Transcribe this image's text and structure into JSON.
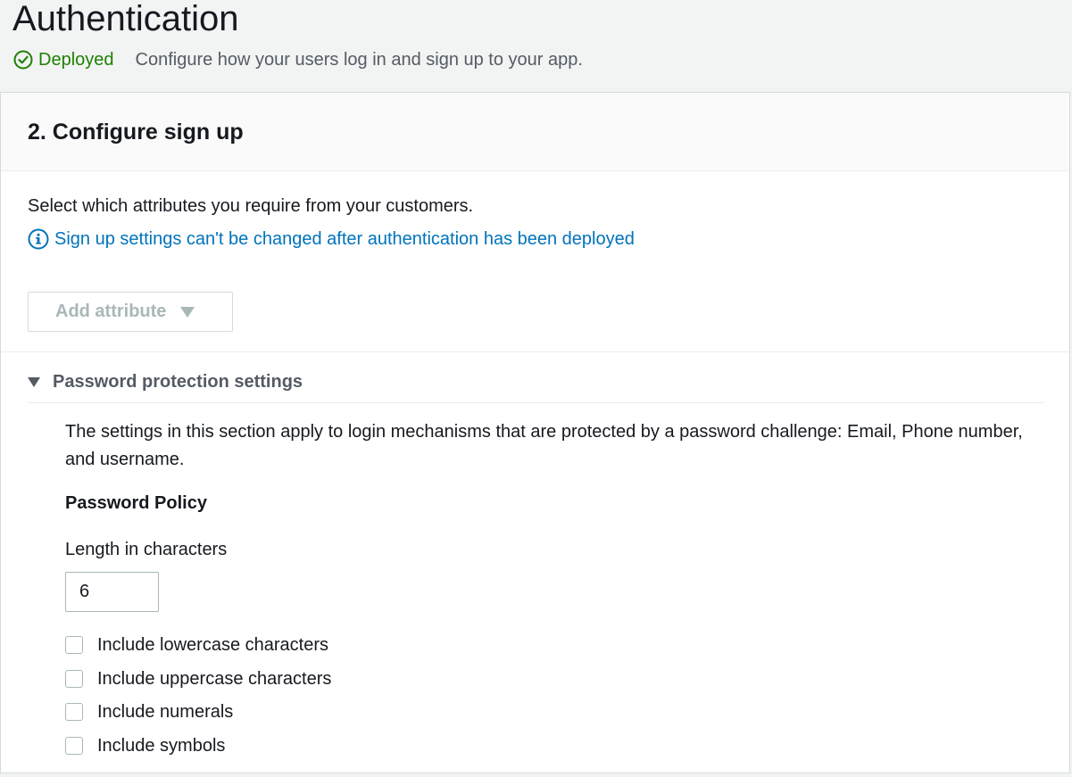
{
  "header": {
    "title": "Authentication",
    "status": "Deployed",
    "subtitle": "Configure how your users log in and sign up to your app."
  },
  "panel": {
    "title": "2. Configure sign up",
    "description": "Select which attributes you require from your customers.",
    "info": "Sign up settings can't be changed after authentication has been deployed",
    "add_attribute_label": "Add attribute"
  },
  "password": {
    "expander_label": "Password protection settings",
    "description": "The settings in this section apply to login mechanisms that are protected by a password challenge: Email, Phone number, and username.",
    "policy_heading": "Password Policy",
    "length_label": "Length in characters",
    "length_value": "6",
    "options": [
      {
        "label": "Include lowercase characters",
        "checked": false
      },
      {
        "label": "Include uppercase characters",
        "checked": false
      },
      {
        "label": "Include numerals",
        "checked": false
      },
      {
        "label": "Include symbols",
        "checked": false
      }
    ]
  },
  "colors": {
    "success": "#1d8102",
    "link": "#0073bb",
    "disabled": "#aab7b8"
  },
  "icons": {
    "status": "check-circle-icon",
    "info": "info-circle-icon",
    "dropdown": "caret-down-icon",
    "expander": "caret-down-icon"
  }
}
